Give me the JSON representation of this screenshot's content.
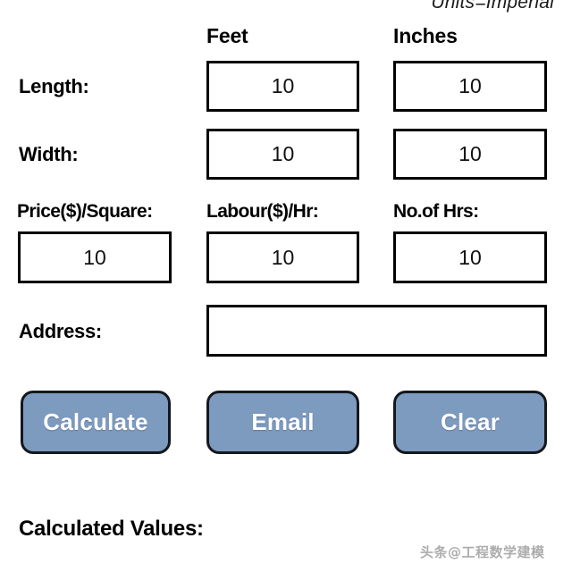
{
  "header": {
    "units_note": "Units=Imperial"
  },
  "columns": {
    "feet": "Feet",
    "inches": "Inches"
  },
  "rows": {
    "length": {
      "label": "Length:",
      "feet_value": "10",
      "inches_value": "10"
    },
    "width": {
      "label": "Width:",
      "feet_value": "10",
      "inches_value": "10"
    },
    "price": {
      "label": "Price($)/Square:",
      "value": "10"
    },
    "labour": {
      "label": "Labour($)/Hr:",
      "value": "10"
    },
    "hours": {
      "label": "No.of Hrs:",
      "value": "10"
    },
    "address": {
      "label": "Address:",
      "value": ""
    }
  },
  "buttons": {
    "calculate": "Calculate",
    "email": "Email",
    "clear": "Clear"
  },
  "results": {
    "heading": "Calculated Values:"
  },
  "watermark": {
    "text": "头条@工程数学建模"
  },
  "colors": {
    "button_fill": "#7d9abf",
    "button_border": "#14181c",
    "button_text": "#ffffff",
    "field_border": "#000000",
    "page_background": "#ffffff",
    "text": "#000000"
  }
}
